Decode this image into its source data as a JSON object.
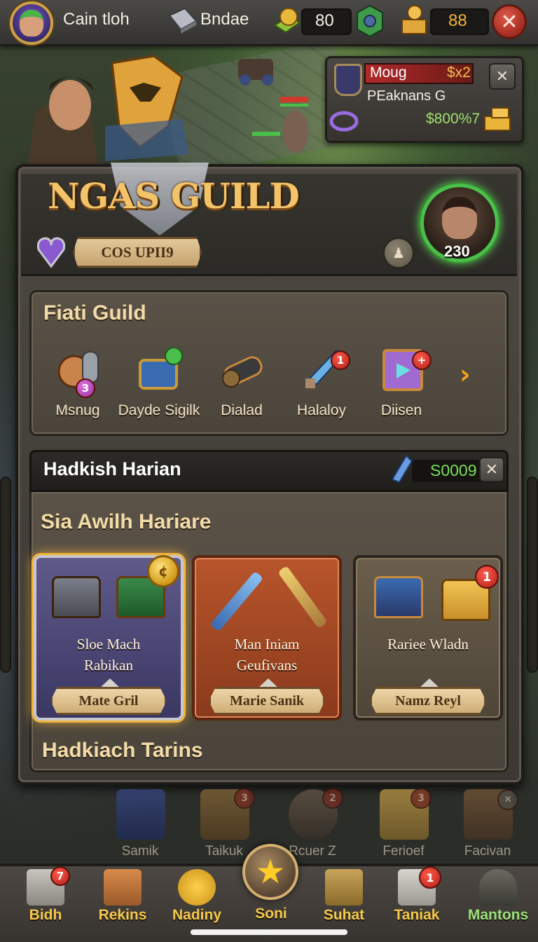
{
  "topbar": {
    "player_name": "Cain tloh",
    "badge_label": "Bndae",
    "currency_1": "80",
    "currency_2": "88",
    "close_symbol": "✕"
  },
  "quest_popup": {
    "name": "Moug",
    "multiplier": "$x2",
    "subtitle": "PEaknans G",
    "reward": "$800%7",
    "close_symbol": "✕"
  },
  "header": {
    "logo_text": "NGAS GUILD",
    "rank_label": "COS UPII9",
    "hero_level": "230"
  },
  "guild_items": {
    "title": "Fiati Guild",
    "items": [
      {
        "label": "Msnug",
        "badge": "3"
      },
      {
        "label": "Dayde Sigilk",
        "badge": ""
      },
      {
        "label": "Dialad",
        "badge": ""
      },
      {
        "label": "Halaloy",
        "badge": "1"
      },
      {
        "label": "Diisen",
        "badge": "+"
      }
    ],
    "next_symbol": "›"
  },
  "trader": {
    "title": "Hadkish Harian",
    "timer": "S0009",
    "close_symbol": "✕",
    "offers_title": "Sia Awilh Hariare",
    "offers": [
      {
        "name_line1": "Sloe Mach",
        "name_line2": "Rabikan",
        "button": "Mate Gril"
      },
      {
        "name_line1": "Man Iniam",
        "name_line2": "Geufivans",
        "button": "Marie Sanik"
      },
      {
        "name_line1": "Rariee Wladn",
        "name_line2": "",
        "button": "Namz Reyl",
        "badge": "1"
      }
    ],
    "footer_title": "Hadkiach Tarins"
  },
  "lower_strip": [
    {
      "label": "Samik",
      "badge": ""
    },
    {
      "label": "Taikuk",
      "badge": "3"
    },
    {
      "label": "Rcuer Z",
      "badge": "2"
    },
    {
      "label": "Ferioef",
      "badge": "3"
    },
    {
      "label": "Facivan",
      "badge": "✕"
    }
  ],
  "bottom_nav": [
    {
      "label": "Bidh",
      "badge": "7"
    },
    {
      "label": "Rekins",
      "badge": ""
    },
    {
      "label": "Nadiny",
      "badge": ""
    },
    {
      "label": "Soni",
      "badge": ""
    },
    {
      "label": "Suhat",
      "badge": ""
    },
    {
      "label": "Taniak",
      "badge": "1"
    },
    {
      "label": "Mantons",
      "badge": ""
    }
  ],
  "colors": {
    "gold_text": "#f3dca8",
    "green_timer": "#7adf5a",
    "nav_gold": "#f6c84a",
    "nav_green": "#9be07a"
  }
}
